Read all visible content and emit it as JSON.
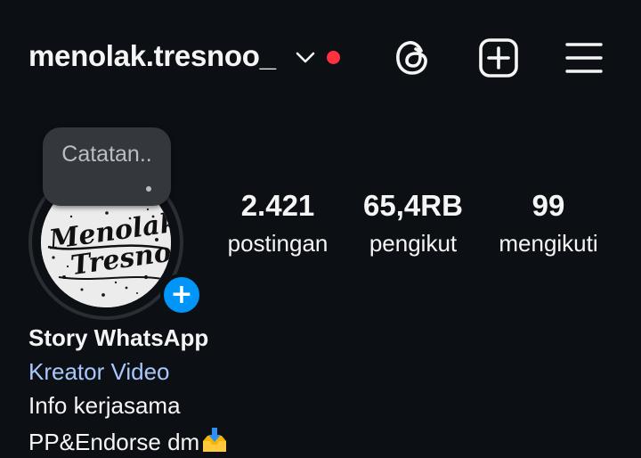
{
  "header": {
    "username": "menolak.tresnoo_",
    "icons": [
      "chevron-down-icon",
      "notification-dot",
      "threads-icon",
      "create-post-icon",
      "hamburger-menu-icon"
    ],
    "accent_dot_color": "#ff3040"
  },
  "note": {
    "text": "Catatan.."
  },
  "avatar": {
    "add_story_icon": "+",
    "add_story_color": "#0095f6"
  },
  "stats": {
    "posts": {
      "value": "2.421",
      "label": "postingan"
    },
    "followers": {
      "value": "65,4RB",
      "label": "pengikut"
    },
    "following": {
      "value": "99",
      "label": "mengikuti"
    }
  },
  "bio": {
    "name": "Story WhatsApp",
    "category": "Kreator Video",
    "category_color": "#a8c7fa",
    "lines": [
      "Info kerjasama",
      "PP&Endorse dm"
    ],
    "emoji": "inbox-tray-icon"
  }
}
